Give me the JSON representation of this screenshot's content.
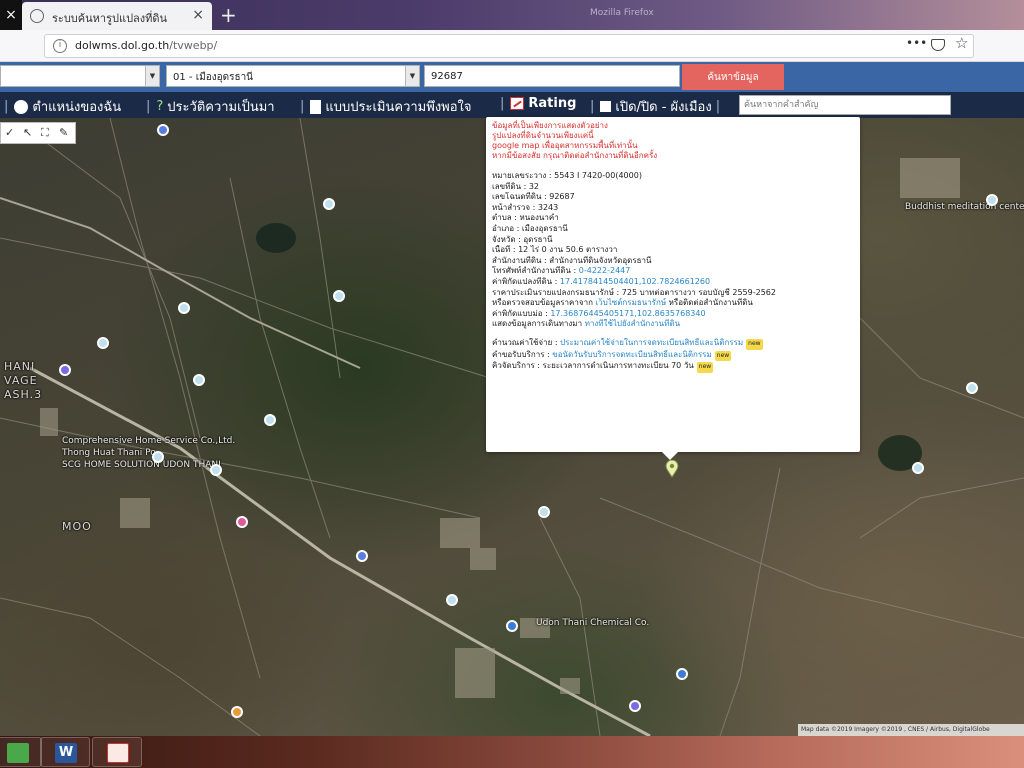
{
  "browser": {
    "close_glyph": "×",
    "tab_title": "ระบบค้นหารูปแปลงที่ดิน",
    "tab_close_glyph": "×",
    "new_tab_glyph": "+",
    "window_caption": "Mozilla Firefox",
    "url_host": "dolwms.dol.go.th",
    "url_path": "/tvwebp/",
    "url_scheme": "",
    "menu_dots": "•••",
    "bookmark_glyph": "☆"
  },
  "search": {
    "province_value": "",
    "district_value": "01 - เมืองอุดรธานี",
    "parcel_value": "92687",
    "button_label": "ค้นหาข้อมูล",
    "arrow_glyph": "▼"
  },
  "menu": {
    "items": [
      {
        "label": "ตำแหน่งของฉัน",
        "icon": "location-icon"
      },
      {
        "label": "ประวัติความเป็นมา",
        "icon": "history-icon"
      },
      {
        "label": "แบบประเมินความพึงพอใจ",
        "icon": "survey-icon"
      },
      {
        "label": "Rating",
        "icon": "rating-chart-icon"
      },
      {
        "label": "เปิด/ปิด - ผังเมือง",
        "icon": "toggle-checkbox-icon"
      }
    ],
    "separator": "|",
    "keyword_placeholder": "ค้นหาจากคำสำคัญ"
  },
  "map": {
    "tools": [
      "✓",
      "↖",
      "⛶",
      "✎"
    ],
    "labels": [
      "HANI",
      "VAGE",
      "ASH.3",
      "MOO",
      "Comprehensive Home Service Co.,Ltd.",
      "Thong Huat Thani Po.",
      "SCG HOME SOLUTION UDON THANI",
      "Udon Thani Chemical Co.",
      "Buddhist meditation center"
    ],
    "attribution": "Map data ©2019 Imagery ©2019 , CNES / Airbus, DigitalGlobe"
  },
  "popup": {
    "warnings": [
      "ข้อมูลที่เป็นเพียงการแสดงตัวอย่าง",
      "รูปแปลงที่ดินจำนวนเพียงแค่นี้",
      "google map เพื่ออุตสาหกรรมพื้นที่เท่านั้น",
      "หากมีข้อสงสัย กรุณาติดต่อสำนักงานที่ดินอีกครั้ง"
    ],
    "fields": [
      {
        "label": "หมายเลขระวาง",
        "value": "5543 I 7420-00(4000)"
      },
      {
        "label": "เลขที่ดิน",
        "value": "32"
      },
      {
        "label": "เลขโฉนดที่ดิน",
        "value": "92687"
      },
      {
        "label": "หน้าสำรวจ",
        "value": "3243"
      },
      {
        "label": "ตำบล",
        "value": "หนองนาคำ"
      },
      {
        "label": "อำเภอ",
        "value": "เมืองอุดรธานี"
      },
      {
        "label": "จังหวัด",
        "value": "อุดรธานี"
      },
      {
        "label": "เนื้อที่",
        "value": "12 ไร่ 0 งาน 50.6 ตารางวา"
      },
      {
        "label": "สำนักงานที่ดิน",
        "value": "สำนักงานที่ดินจังหวัดอุดรธานี"
      },
      {
        "label": "โทรศัพท์สำนักงานที่ดิน",
        "value": "0-4222-2447"
      }
    ],
    "lat_lng_label": "ค่าพิกัดแปลงที่ดิน",
    "lat_lng_value": "17.4178414504401,102.7824661260",
    "price_label": "ราคาประเมินรายแปลงกรมธนารักษ์",
    "price_value": "725 บาทต่อตารางวา รอบบัญชี 2559-2562",
    "check_label": "หรือตรวจสอบข้อมูลราคาจาก",
    "check_link": "เว็บไซต์กรมธนารักษ์",
    "check_suffix": "หรือติดต่อสำนักงานที่ดิน",
    "office_coord_label": "ค่าพิกัดแบบม่อ",
    "office_coord_value": "17.36876445405171,102.8635768340",
    "route_label": "แสดงข้อมูลการเดินทางมา",
    "route_link": "ทางที่ใช้ไปยังสำนักงานที่ดิน",
    "services": [
      {
        "label": "คำนวณค่าใช้จ่าย",
        "value": "ประมาณค่าใช้จ่ายในการจดทะเบียนสิทธิ์และนิติกรรม"
      },
      {
        "label": "คำขอรับบริการ",
        "value": "ขอนัดวันรับบริการจดทะเบียนสิทธิ์และนิติกรรม"
      },
      {
        "label": "คิวจัดบริการ",
        "value": "ระยะเวลาการดำเนินการทางทะเบียน 70 วัน"
      }
    ],
    "new_badge": "new"
  },
  "taskbar": {
    "apps": [
      {
        "name": "green-app-icon",
        "glyph": ""
      },
      {
        "name": "word-icon",
        "glyph": "W"
      },
      {
        "name": "powerpoint-icon",
        "glyph": ""
      }
    ]
  },
  "colors": {
    "search_bg": "#3a66a6",
    "menubar_bg": "#1b2a46",
    "search_button": "#e46460",
    "warn_text": "#d9302b",
    "link_text": "#2a86c8"
  }
}
